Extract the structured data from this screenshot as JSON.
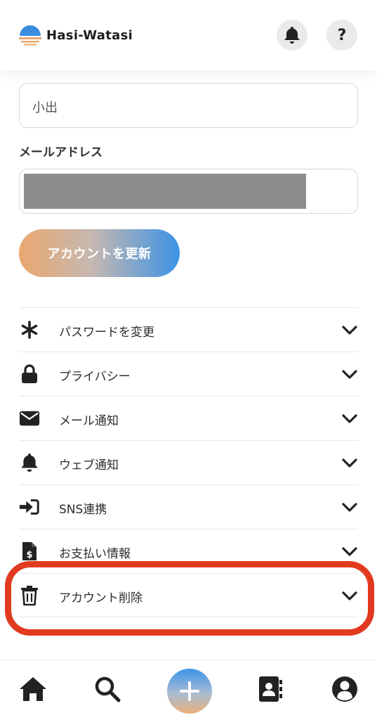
{
  "app": {
    "name": "Hasi-Watasi"
  },
  "header": {
    "help_label": "?"
  },
  "form": {
    "name_value": "小出",
    "email_label": "メールアドレス",
    "update_button": "アカウントを更新"
  },
  "settings": {
    "items": [
      {
        "label": "パスワードを変更",
        "icon": "asterisk-icon"
      },
      {
        "label": "プライバシー",
        "icon": "lock-icon"
      },
      {
        "label": "メール通知",
        "icon": "envelope-icon"
      },
      {
        "label": "ウェブ通知",
        "icon": "bell-icon"
      },
      {
        "label": "SNS連携",
        "icon": "sign-in-icon"
      },
      {
        "label": "お支払い情報",
        "icon": "invoice-dollar-icon"
      },
      {
        "label": "アカウント削除",
        "icon": "trash-icon"
      }
    ]
  },
  "colors": {
    "highlight": "#e23a1f",
    "accent_blue": "#3b93e6",
    "accent_orange": "#e9a76f"
  }
}
